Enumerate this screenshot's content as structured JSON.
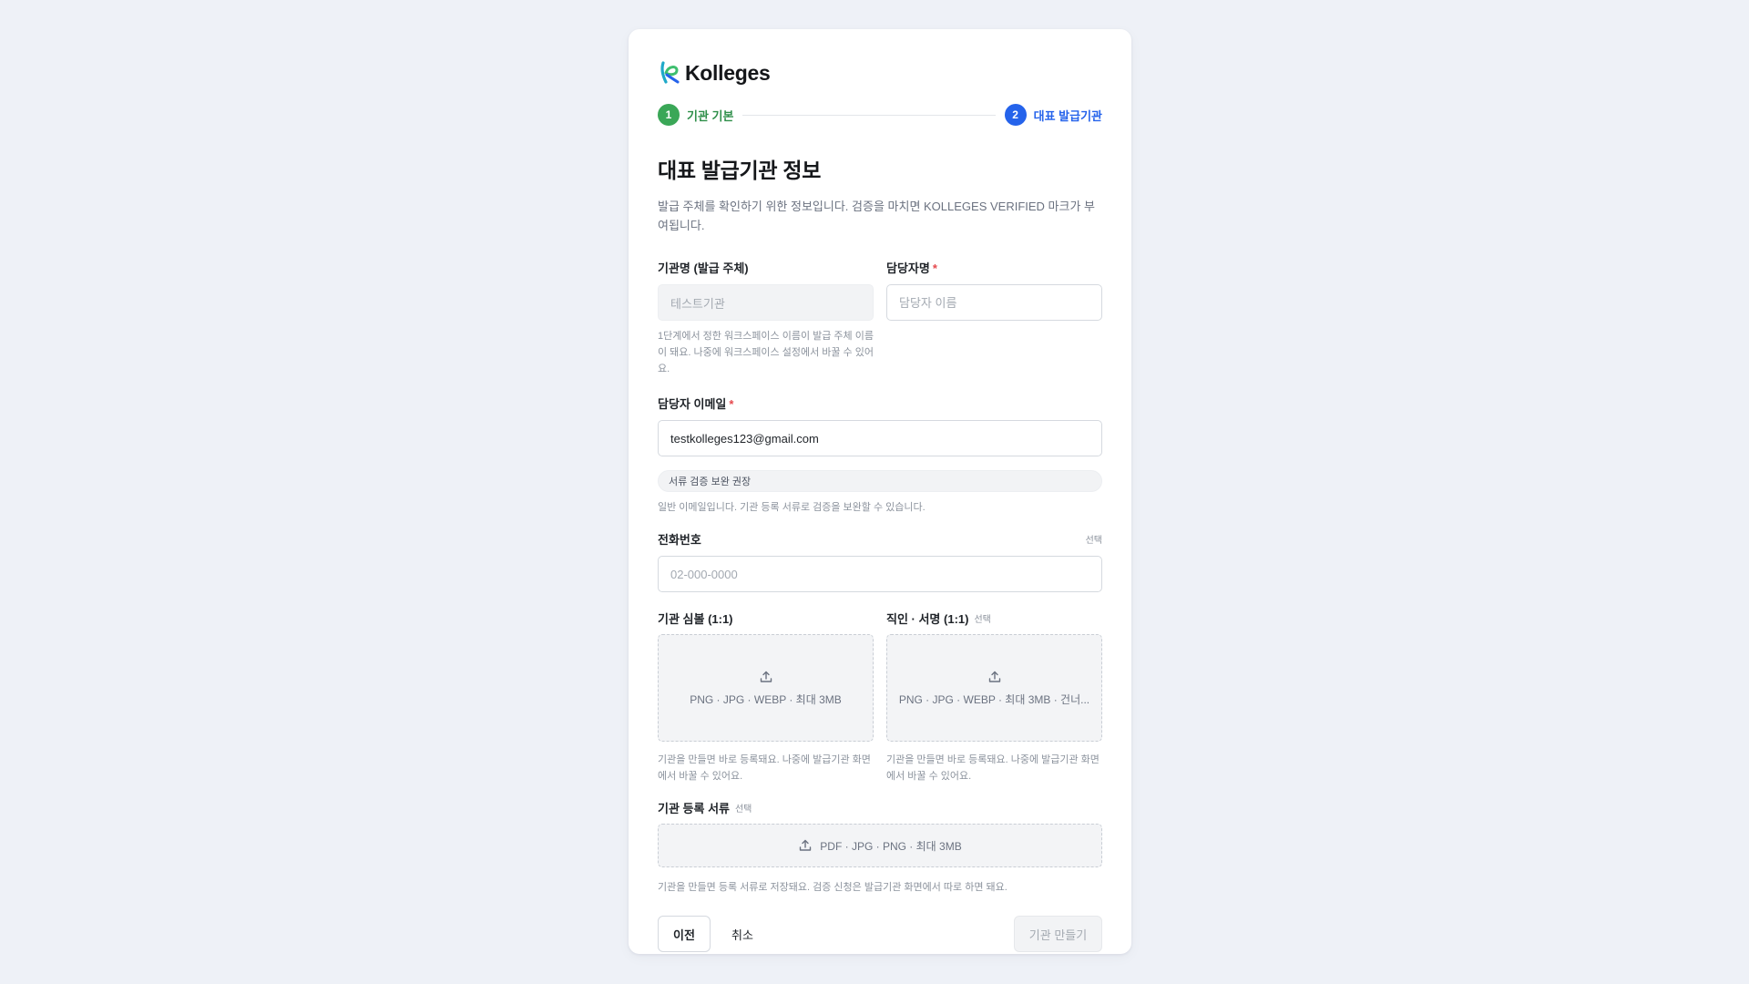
{
  "brand": {
    "name": "Kolleges"
  },
  "colors": {
    "step_done": "#3aa757",
    "step_active": "#2563eb",
    "required": "#e5484d"
  },
  "steps": [
    {
      "number": "1",
      "label": "기관 기본"
    },
    {
      "number": "2",
      "label": "대표 발급기관"
    }
  ],
  "page": {
    "title": "대표 발급기관 정보",
    "description": "발급 주체를 확인하기 위한 정보입니다. 검증을 마치면 KOLLEGES VERIFIED 마크가 부여됩니다."
  },
  "form": {
    "org_name": {
      "label": "기관명 (발급 주체)",
      "value": "테스트기관",
      "hint": "1단계에서 정한 워크스페이스 이름이 발급 주체 이름이 돼요. 나중에 워크스페이스 설정에서 바꿀 수 있어요."
    },
    "contact_name": {
      "label": "담당자명",
      "required_mark": "*",
      "placeholder": "담당자 이름"
    },
    "contact_email": {
      "label": "담당자 이메일",
      "required_mark": "*",
      "value": "testkolleges123@gmail.com",
      "chip": "서류 검증 보완 권장",
      "hint": "일반 이메일입니다. 기관 등록 서류로 검증을 보완할 수 있습니다."
    },
    "phone": {
      "label": "전화번호",
      "optional": "선택",
      "placeholder": "02-000-0000"
    },
    "seal": {
      "label": "기관 심볼 (1:1)",
      "drop_text": "PNG · JPG · WEBP · 최대 3MB",
      "hint": "기관을 만들면 바로 등록돼요. 나중에 발급기관 화면에서 바꿀 수 있어요."
    },
    "signature": {
      "label": "직인 · 서명 (1:1)",
      "optional": "선택",
      "drop_text": "PNG · JPG · WEBP · 최대 3MB · 건너...",
      "hint": "기관을 만들면 바로 등록돼요. 나중에 발급기관 화면에서 바꿀 수 있어요."
    },
    "registration_doc": {
      "label": "기관 등록 서류",
      "optional": "선택",
      "drop_text": "PDF · JPG · PNG · 최대 3MB",
      "hint": "기관을 만들면 등록 서류로 저장돼요. 검증 신청은 발급기관 화면에서 따로 하면 돼요."
    }
  },
  "buttons": {
    "prev": "이전",
    "cancel": "취소",
    "create": "기관 만들기"
  }
}
